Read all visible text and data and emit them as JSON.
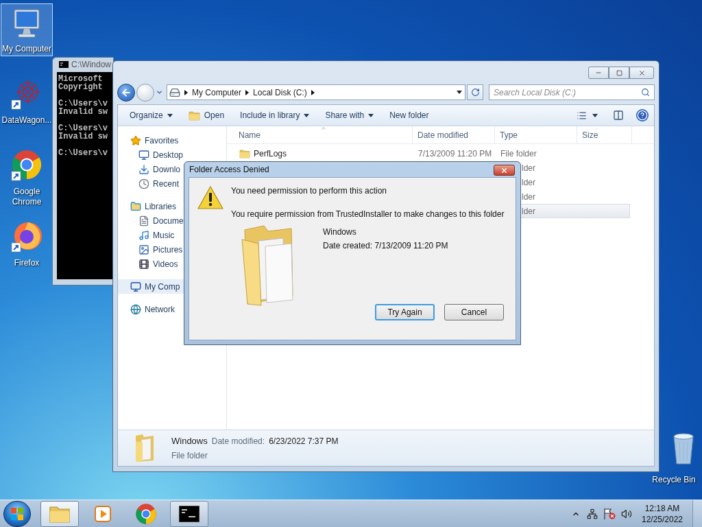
{
  "desktop": {
    "icons": [
      {
        "label": "My Computer",
        "kind": "computer",
        "selected": true
      },
      {
        "label": "DataWagon...",
        "kind": "datawagon",
        "selected": false
      },
      {
        "label": "Google Chrome",
        "kind": "chrome",
        "selected": false
      },
      {
        "label": "Firefox",
        "kind": "firefox",
        "selected": false
      }
    ],
    "recycle_bin": {
      "label": "Recycle Bin"
    }
  },
  "console_window": {
    "title": "C:\\Window",
    "blocks": [
      [
        "Microsoft",
        "Copyright"
      ],
      [
        "C:\\Users\\v",
        "Invalid sw"
      ],
      [
        "C:\\Users\\v",
        "Invalid sw"
      ],
      [
        "C:\\Users\\v"
      ]
    ]
  },
  "explorer": {
    "breadcrumb": [
      "My Computer",
      "Local Disk (C:)"
    ],
    "search": {
      "placeholder": "Search Local Disk (C:)"
    },
    "toolbar": [
      {
        "label": "Organize",
        "kind": "menu"
      },
      {
        "label": "Open",
        "kind": "open"
      },
      {
        "label": "Include in library",
        "kind": "menu"
      },
      {
        "label": "Share with",
        "kind": "menu"
      },
      {
        "label": "New folder",
        "kind": "plain"
      }
    ],
    "navigation": [
      {
        "label": "Favorites",
        "kind": "favorites",
        "selected": false,
        "children": [
          {
            "label": "Desktop",
            "kind": "desktop",
            "selected": false
          },
          {
            "label": "Downlo",
            "kind": "downloads",
            "selected": false
          },
          {
            "label": "Recent",
            "kind": "recent",
            "selected": false
          }
        ]
      },
      {
        "label": "Libraries",
        "kind": "libraries",
        "selected": false,
        "children": [
          {
            "label": "Docume",
            "kind": "documents",
            "selected": false
          },
          {
            "label": "Music",
            "kind": "music",
            "selected": false
          },
          {
            "label": "Pictures",
            "kind": "pictures",
            "selected": false
          },
          {
            "label": "Videos",
            "kind": "videos",
            "selected": false
          }
        ]
      },
      {
        "label": "My Comp",
        "kind": "computer",
        "selected": true
      },
      {
        "label": "Network",
        "kind": "network",
        "selected": false
      }
    ],
    "columns": [
      "Name",
      "Date modified",
      "Type",
      "Size"
    ],
    "rows": [
      {
        "name": "PerfLogs",
        "date_modified": "7/13/2009 11:20 PM",
        "type": "File folder",
        "selected": false
      },
      {
        "type": "lder",
        "selected": false
      },
      {
        "type": "lder",
        "selected": false
      },
      {
        "type": "lder",
        "selected": false
      },
      {
        "type": "lder",
        "selected": true
      }
    ],
    "details": {
      "name": "Windows",
      "date_label": "Date modified:",
      "date": "6/23/2022 7:37 PM",
      "type": "File folder"
    }
  },
  "dialog": {
    "title": "Folder Access Denied",
    "heading": "You need permission to perform this action",
    "message": "You require permission from TrustedInstaller to make changes to this folder",
    "item_name": "Windows",
    "item_date": "Date created: 7/13/2009 11:20 PM",
    "buttons": [
      {
        "label": "Try Again",
        "selected": true
      },
      {
        "label": "Cancel",
        "selected": false
      }
    ]
  },
  "taskbar": {
    "items": [
      {
        "kind": "explorer",
        "open": true,
        "selected": true
      },
      {
        "kind": "media",
        "open": false,
        "selected": false
      },
      {
        "kind": "chrome",
        "open": false,
        "selected": false
      },
      {
        "kind": "console",
        "open": true,
        "selected": false
      }
    ],
    "clock": {
      "time": "12:18 AM",
      "date": "12/25/2022"
    }
  }
}
